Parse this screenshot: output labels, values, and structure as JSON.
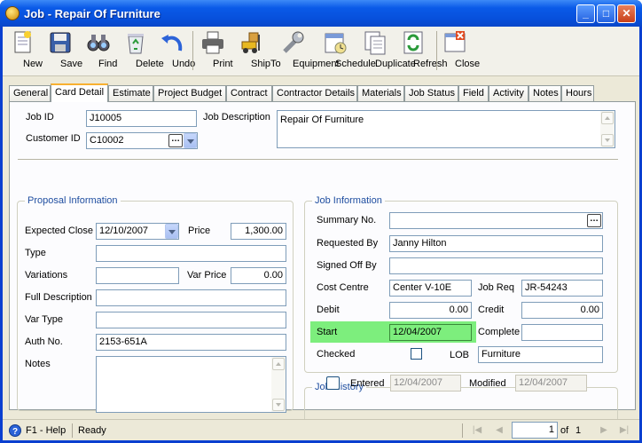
{
  "window": {
    "title": "Job - Repair Of Furniture"
  },
  "toolbar": {
    "new": "New",
    "save": "Save",
    "find": "Find",
    "delete": "Delete",
    "undo": "Undo",
    "print": "Print",
    "shipto": "ShipTo",
    "equipment": "Equipment",
    "schedule": "Schedule",
    "duplicate": "Duplicate",
    "refresh": "Refresh",
    "close": "Close"
  },
  "tabs": [
    "General",
    "Card Detail",
    "Estimate",
    "Project Budget",
    "Contract",
    "Contractor Details",
    "Materials",
    "Job Status",
    "Field",
    "Activity",
    "Notes",
    "Hours"
  ],
  "header": {
    "job_id_label": "Job ID",
    "job_id": "J10005",
    "job_desc_label": "Job Description",
    "job_desc": "Repair Of Furniture",
    "customer_id_label": "Customer ID",
    "customer_id": "C10002"
  },
  "proposal": {
    "title": "Proposal Information",
    "expected_close_label": "Expected Close",
    "expected_close": "12/10/2007",
    "price_label": "Price",
    "price": "1,300.00",
    "type_label": "Type",
    "type": "",
    "variations_label": "Variations",
    "variations": "",
    "var_price_label": "Var Price",
    "var_price": "0.00",
    "full_desc_label": "Full Description",
    "full_desc": "",
    "var_type_label": "Var Type",
    "var_type": "",
    "auth_no_label": "Auth No.",
    "auth_no": "2153-651A",
    "notes_label": "Notes",
    "notes": ""
  },
  "jobinfo": {
    "title": "Job Information",
    "summary_no_label": "Summary No.",
    "summary_no": "",
    "requested_by_label": "Requested By",
    "requested_by": "Janny Hilton",
    "signed_off_by_label": "Signed Off By",
    "signed_off_by": "",
    "cost_centre_label": "Cost Centre",
    "cost_centre": "Center V-10E",
    "job_req_label": "Job Req",
    "job_req": "JR-54243",
    "debit_label": "Debit",
    "debit": "0.00",
    "credit_label": "Credit",
    "credit": "0.00",
    "start_label": "Start",
    "start": "12/04/2007",
    "complete_label": "Complete",
    "complete": "",
    "checked_label": "Checked",
    "lob_label": "LOB",
    "lob": "Furniture"
  },
  "history": {
    "title": "Job History",
    "entered_label": "Entered",
    "entered": "12/04/2007",
    "modified_label": "Modified",
    "modified": "12/04/2007"
  },
  "status": {
    "help": "F1 - Help",
    "ready": "Ready",
    "page": "1",
    "of_label": "of",
    "total": "1"
  },
  "colors": {
    "title_blue": "#0a5ae8",
    "highlight": "#7dee7d",
    "group_title": "#1f4ea0"
  }
}
